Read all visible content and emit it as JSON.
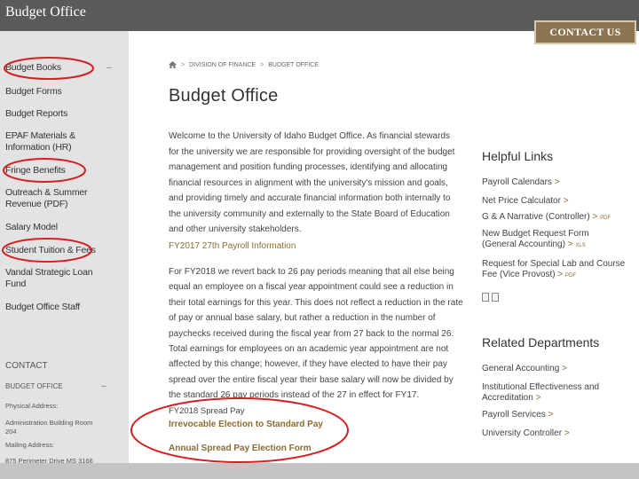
{
  "window": {
    "title": "Budget Office"
  },
  "header": {
    "contact_button": "CONTACT US"
  },
  "breadcrumb": {
    "home_icon": "home-icon",
    "items": [
      "DIVISION OF FINANCE",
      "BUDGET OFFICE"
    ],
    "sep": ">"
  },
  "sidebar": {
    "items": [
      "Budget Books",
      "Budget Forms",
      "Budget Reports",
      "EPAF Materials & Information (HR)",
      "Fringe Benefits",
      "Outreach & Summer Revenue (PDF)",
      "Salary Model",
      "Student Tuition & Fees",
      "Vandal Strategic Loan Fund",
      "Budget Office Staff"
    ],
    "collapse_symbol": "–",
    "contact": {
      "heading": "CONTACT",
      "office": "BUDGET OFFICE",
      "physical_label": "Physical Address:",
      "physical_value": "Administration Building Room 204",
      "mailing_label": "Mailing Address:",
      "mailing_value": "875 Perimeter Drive MS 3166"
    }
  },
  "main": {
    "title": "Budget Office",
    "intro": "Welcome to the University of Idaho Budget Office. As financial stewards for the university we are responsible for providing oversight of the budget management and position funding processes, identifying and allocating financial resources in alignment with the university's mission and goals, and providing timely and accurate financial information both internally to the university community and externally to the State Board of Education and other university stakeholders.",
    "payroll_link": "FY2017 27th Payroll Information",
    "payroll_body": "For FY2018 we revert back to 26 pay periods meaning that all else being equal an employee on a fiscal year appointment could see a reduction in their total earnings for this year. This does not reflect a reduction in the rate of pay or annual base salary, but rather a reduction in the number of paychecks received during the fiscal year from 27 back to the normal 26. Total earnings for employees on an academic year appointment are not affected by this change; however, if they have elected to have their pay spread over the entire fiscal year their base salary will now be divided by the standard 26 pay periods instead of the 27 in effect for FY17.",
    "spread_label": "FY2018 Spread Pay",
    "spread_link1": "Irrevocable Election to Standard Pay",
    "spread_link2": "Annual Spread Pay Election Form"
  },
  "aside": {
    "helpful_heading": "Helpful Links",
    "helpful": [
      {
        "text": "Payroll Calendars",
        "arrow": ">",
        "tag": ""
      },
      {
        "text": "Net Price Calculator",
        "arrow": ">",
        "tag": ""
      },
      {
        "text": "G & A Narrative (Controller)",
        "arrow": ">",
        "tag": "PDF"
      },
      {
        "text": "New Budget Request Form (General Accounting)",
        "arrow": ">",
        "tag": "XLS"
      },
      {
        "text": "Request for Special Lab and Course Fee (Vice Provost)",
        "arrow": ">",
        "tag": "PDF"
      }
    ],
    "related_heading": "Related Departments",
    "related": [
      {
        "text": "General Accounting",
        "arrow": ">"
      },
      {
        "text": "Institutional Effectiveness and Accreditation",
        "arrow": ">"
      },
      {
        "text": "Payroll Services",
        "arrow": ">"
      },
      {
        "text": "University Controller",
        "arrow": ">"
      }
    ]
  },
  "colors": {
    "accent_gold": "#8c6d32",
    "contact_bg": "#8c7451",
    "annotation_red": "#d42020",
    "titlebar": "#5a5a5a",
    "sidebar_bg": "#e3e3e3"
  }
}
